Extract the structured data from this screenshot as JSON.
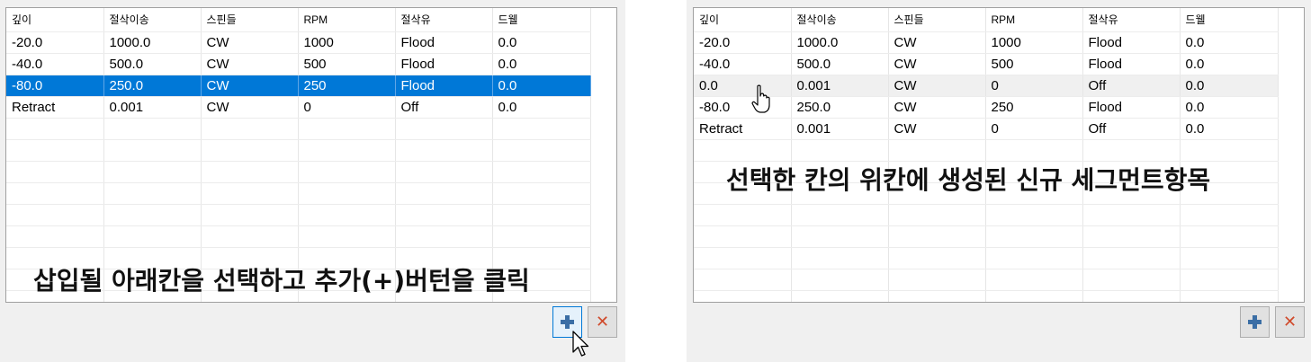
{
  "columns": [
    "깊이",
    "절삭이송",
    "스핀들",
    "RPM",
    "절삭유",
    "드웰"
  ],
  "left_panel": {
    "rows": [
      [
        "-20.0",
        "1000.0",
        "CW",
        "1000",
        "Flood",
        "0.0"
      ],
      [
        "-40.0",
        "500.0",
        "CW",
        "500",
        "Flood",
        "0.0"
      ],
      [
        "-80.0",
        "250.0",
        "CW",
        "250",
        "Flood",
        "0.0"
      ],
      [
        "Retract",
        "0.001",
        "CW",
        "0",
        "Off",
        "0.0"
      ]
    ],
    "selected_row_index": 2,
    "caption": "삽입될 아래칸을 선택하고 추가(+)버턴을 클릭"
  },
  "right_panel": {
    "rows": [
      [
        "-20.0",
        "1000.0",
        "CW",
        "1000",
        "Flood",
        "0.0"
      ],
      [
        "-40.0",
        "500.0",
        "CW",
        "500",
        "Flood",
        "0.0"
      ],
      [
        "0.0",
        "0.001",
        "CW",
        "0",
        "Off",
        "0.0"
      ],
      [
        "-80.0",
        "250.0",
        "CW",
        "250",
        "Flood",
        "0.0"
      ],
      [
        "Retract",
        "0.001",
        "CW",
        "0",
        "Off",
        "0.0"
      ]
    ],
    "hovered_row_index": 2,
    "caption": "선택한 칸의 위칸에 생성된 신규 세그먼트항목"
  },
  "buttons": {
    "add_icon": "plus-icon",
    "delete_icon": "close-icon",
    "delete_glyph": "✕"
  },
  "colors": {
    "selection": "#0078d7",
    "hover_row": "#f0f0f0",
    "add_icon": "#3b6ea5",
    "delete_icon": "#d04a2b"
  }
}
